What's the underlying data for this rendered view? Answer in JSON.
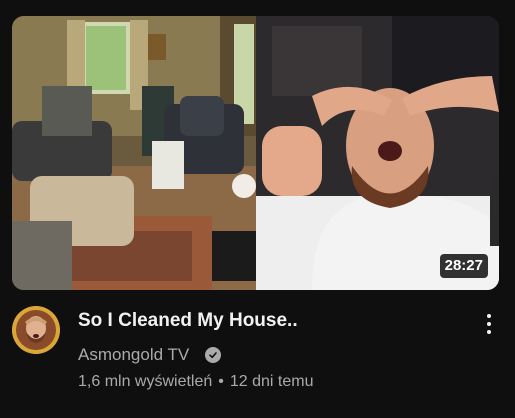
{
  "video": {
    "title": "So I Cleaned My House..",
    "duration": "28:27",
    "channel": "Asmongold TV",
    "views": "1,6 mln wyświetleń",
    "separator": "•",
    "age": "12 dni temu",
    "verified_icon": "verified-check-icon",
    "menu_icon": "more-vert-icon",
    "thumbnail_scene": "messy-room-and-man-reacting"
  },
  "colors": {
    "background": "#0f0f0f",
    "title": "#f1f1f1",
    "meta": "#aaaaaa",
    "avatar_ring": "#d9a637"
  }
}
